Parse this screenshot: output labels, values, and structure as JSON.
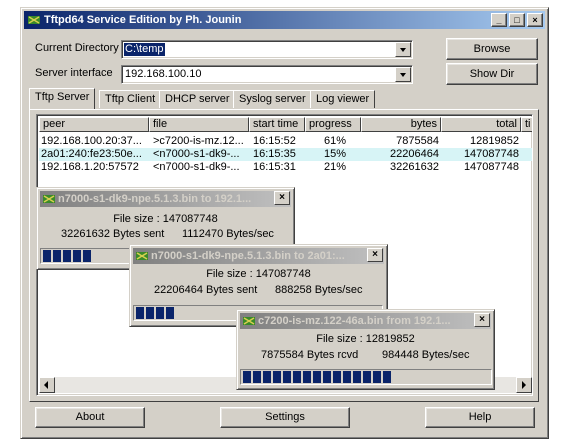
{
  "window": {
    "title": "Tftpd64 Service Edition by Ph. Jounin"
  },
  "caption_buttons": {
    "minimize": "_",
    "maximize": "□",
    "close": "×"
  },
  "current_directory": {
    "label": "Current Directory",
    "value": "C:\\temp"
  },
  "server_interface": {
    "label": "Server interface",
    "value": "192.168.100.10"
  },
  "buttons": {
    "browse": "Browse",
    "show_dir": "Show Dir",
    "about": "About",
    "settings": "Settings",
    "help": "Help"
  },
  "tabs": [
    "Tftp Server",
    "Tftp Client",
    "DHCP server",
    "Syslog server",
    "Log viewer"
  ],
  "active_tab": "Tftp Server",
  "table": {
    "columns": [
      "peer",
      "file",
      "start time",
      "progress",
      "bytes",
      "total",
      "ti"
    ],
    "rows": [
      {
        "peer": "192.168.100.20:37...",
        "file": ">c7200-is-mz.12...",
        "start": "16:15:52",
        "progress": "61%",
        "bytes": "7875584",
        "total": "12819852",
        "selected": false
      },
      {
        "peer": "2a01:240:fe23:50e...",
        "file": "<n7000-s1-dk9-...",
        "start": "16:15:35",
        "progress": "15%",
        "bytes": "22206464",
        "total": "147087748",
        "selected": true
      },
      {
        "peer": "192.168.1.20:57572",
        "file": "<n7000-s1-dk9-...",
        "start": "16:15:31",
        "progress": "21%",
        "bytes": "32261632",
        "total": "147087748",
        "selected": false
      }
    ]
  },
  "transfers": [
    {
      "title": "n7000-s1-dk9-npe.5.1.3.bin to 192.1...",
      "file_size": "File size : 147087748",
      "bytes_text": "32261632 Bytes sent",
      "rate": "1112470 Bytes/sec",
      "progress": 0.21
    },
    {
      "title": "n7000-s1-dk9-npe.5.1.3.bin to 2a01:...",
      "file_size": "File size : 147087748",
      "bytes_text": "22206464 Bytes sent",
      "rate": "888258 Bytes/sec",
      "progress": 0.15
    },
    {
      "title": "c7200-is-mz.122-46a.bin from 192.1...",
      "file_size": "File size : 12819852",
      "bytes_text": "7875584 Bytes rcvd",
      "rate": "984448 Bytes/sec",
      "progress": 0.61
    }
  ],
  "colors": {
    "selection": "#d7f4f6",
    "title_active": "#0a246a",
    "progress": "#0a246a"
  }
}
